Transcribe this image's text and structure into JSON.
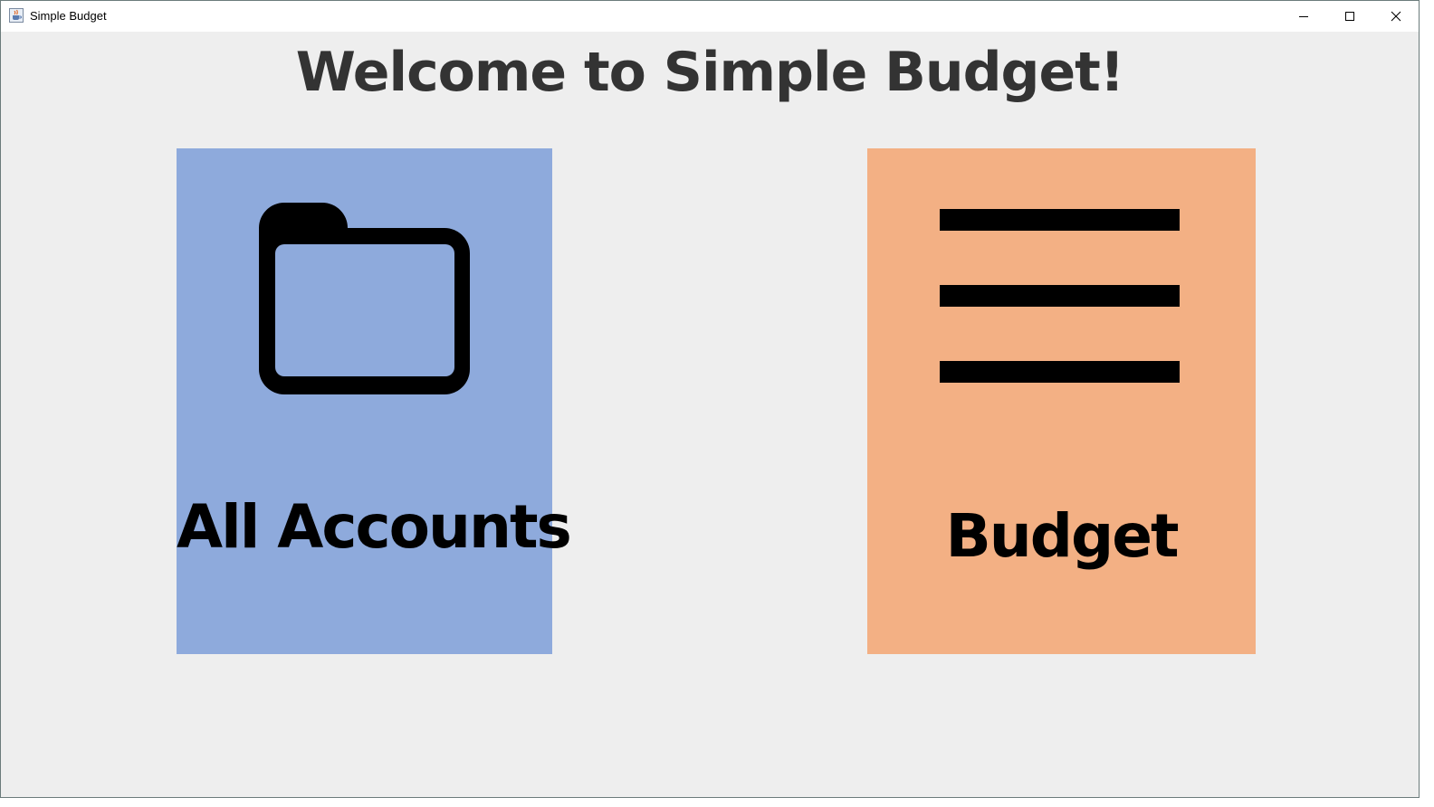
{
  "window": {
    "title": "Simple Budget",
    "icon": "java-cup-icon",
    "controls": {
      "minimize": "minimize-icon",
      "maximize": "maximize-icon",
      "close": "close-icon"
    }
  },
  "main": {
    "heading": "Welcome to Simple Budget!",
    "tiles": [
      {
        "label": "All Accounts",
        "icon": "folder-icon",
        "color": "#8eaadc"
      },
      {
        "label": "Budget",
        "icon": "menu-lines-icon",
        "color": "#f3b084"
      }
    ]
  },
  "colors": {
    "background": "#eeeeee",
    "heading": "#333333"
  }
}
